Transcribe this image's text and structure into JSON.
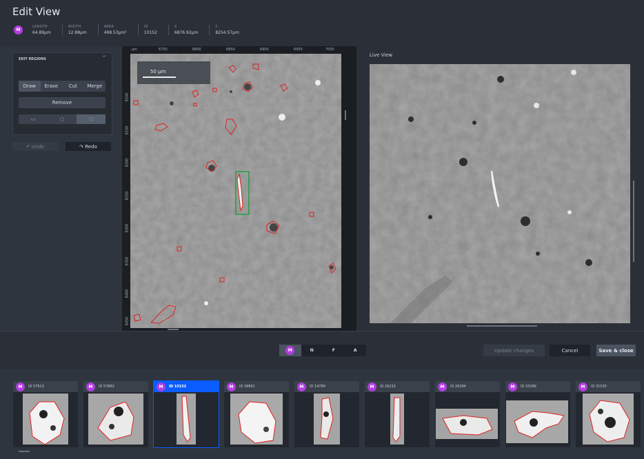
{
  "header": {
    "title": "Edit View",
    "badge": "M",
    "stats": [
      {
        "key": "LENGTH",
        "value": "64.89µm"
      },
      {
        "key": "WIDTH",
        "value": "12.88µm"
      },
      {
        "key": "AREA",
        "value": "498.53µm²"
      },
      {
        "key": "ID",
        "value": "10152"
      },
      {
        "key": "X",
        "value": "6876.92µm"
      },
      {
        "key": "Y",
        "value": "8254.57µm"
      }
    ]
  },
  "edit_regions": {
    "title": "EDIT REGIONS",
    "caret": "^",
    "tools": [
      "Draw",
      "Erase",
      "Cut",
      "Merge"
    ],
    "active_tool": "Draw",
    "remove_label": "Remove",
    "shapes": [
      "▭",
      "○",
      "⬡"
    ],
    "undo_label": "↶ Undo",
    "redo_label": "↷ Redo"
  },
  "main_view": {
    "ruler_unit": "µm",
    "x_ticks": [
      "6750",
      "6800",
      "6850",
      "6900",
      "6950",
      "7000"
    ],
    "y_ticks": [
      "8100",
      "8150",
      "8200",
      "8250",
      "8300",
      "8350",
      "8400",
      "8450"
    ],
    "scale_bar_label": "50 µm"
  },
  "live_view": {
    "label": "Live View"
  },
  "modes": [
    "M",
    "N",
    "F",
    "A"
  ],
  "active_mode": "M",
  "actions": {
    "update_label": "Update changes",
    "cancel_label": "Cancel",
    "save_close_label": "Save & close"
  },
  "filmstrip": [
    {
      "badge": "M",
      "id": "ID 57913"
    },
    {
      "badge": "M",
      "id": "ID 57882"
    },
    {
      "badge": "M",
      "id": "ID 10152",
      "active": true
    },
    {
      "badge": "M",
      "id": "ID 36861"
    },
    {
      "badge": "M",
      "id": "ID 14789"
    },
    {
      "badge": "M",
      "id": "ID 26232"
    },
    {
      "badge": "M",
      "id": "ID 26294"
    },
    {
      "badge": "M",
      "id": "ID 33289"
    },
    {
      "badge": "M",
      "id": "ID 31530"
    }
  ],
  "colors": {
    "accent": "#0b5cff",
    "badge": "#b13fe0",
    "outline": "#e02020",
    "selection": "#22a03a"
  }
}
